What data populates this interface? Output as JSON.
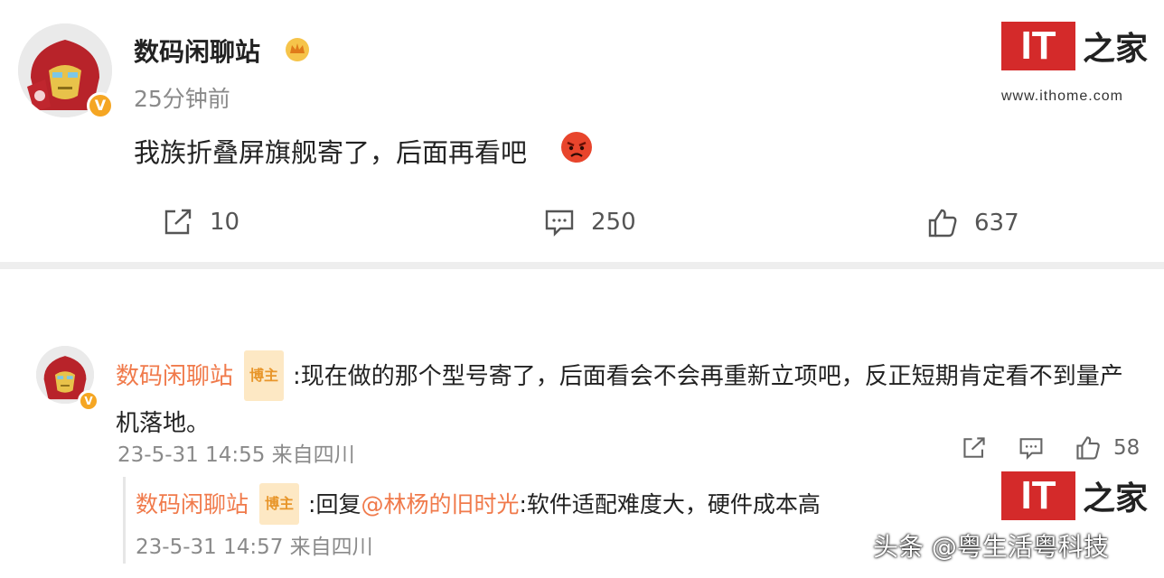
{
  "post": {
    "author": "数码闲聊站",
    "time": "25分钟前",
    "content": "我族折叠屏旗舰寄了，后面再看吧",
    "verified_badge": "V",
    "reposts": "10",
    "comments": "250",
    "likes": "637"
  },
  "comment": {
    "author": "数码闲聊站",
    "tag": "博主",
    "text": ":现在做的那个型号寄了，后面看会不会再重新立项吧，反正短期肯定看不到量产机落地。",
    "meta": "23-5-31 14:55 来自四川",
    "likes": "58",
    "verified_badge": "V"
  },
  "reply": {
    "author": "数码闲聊站",
    "tag": "博主",
    "prefix": ":回复",
    "mention": "@林杨的旧时光",
    "text": ":软件适配难度大，硬件成本高",
    "meta": "23-5-31 14:57 来自四川"
  },
  "watermark": {
    "logo_it": "IT",
    "logo_home": "之家",
    "url": "www.ithome.com"
  },
  "footer": {
    "credit": "头条 @粤生活粤科技"
  },
  "colors": {
    "accent_name": "#f07a4b",
    "logo_red": "#d42a2a",
    "badge": "#f5a623",
    "tag_bg": "#fde8c4"
  }
}
